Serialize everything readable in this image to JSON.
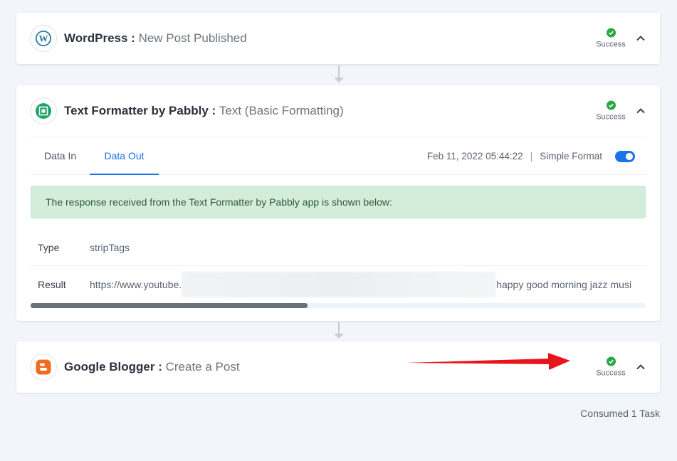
{
  "workflow": {
    "steps": [
      {
        "app_name": "WordPress",
        "separator": " : ",
        "event": "New Post Published",
        "status": "Success"
      },
      {
        "app_name": "Text Formatter by Pabbly",
        "separator": " : ",
        "event": "Text (Basic Formatting)",
        "status": "Success"
      },
      {
        "app_name": "Google Blogger",
        "separator": " : ",
        "event": "Create a Post",
        "status": "Success"
      }
    ],
    "details": {
      "tabs": [
        {
          "label": "Data In",
          "active": false
        },
        {
          "label": "Data Out",
          "active": true
        }
      ],
      "timestamp": "Feb 11, 2022 05:44:22",
      "pipe": "|",
      "format_label": "Simple Format",
      "format_on": true,
      "alert": "The response received from the Text Formatter by Pabbly app is shown below:",
      "rows": [
        {
          "key": "Type",
          "value": "stripTags"
        },
        {
          "key": "Result",
          "value_prefix": "https://www.youtube.",
          "value_suffix": "happy good morning jazz musi"
        }
      ],
      "scroll_fraction": 0.45
    },
    "footer": "Consumed 1 Task"
  },
  "colors": {
    "accent": "#1a73e8",
    "success": "#28a745",
    "alert_bg": "#d4edda",
    "annotation_arrow": "#e8141b"
  },
  "icons": [
    "wordpress-icon",
    "text-formatter-icon",
    "blogger-icon",
    "check-icon",
    "chevron-up-icon"
  ]
}
